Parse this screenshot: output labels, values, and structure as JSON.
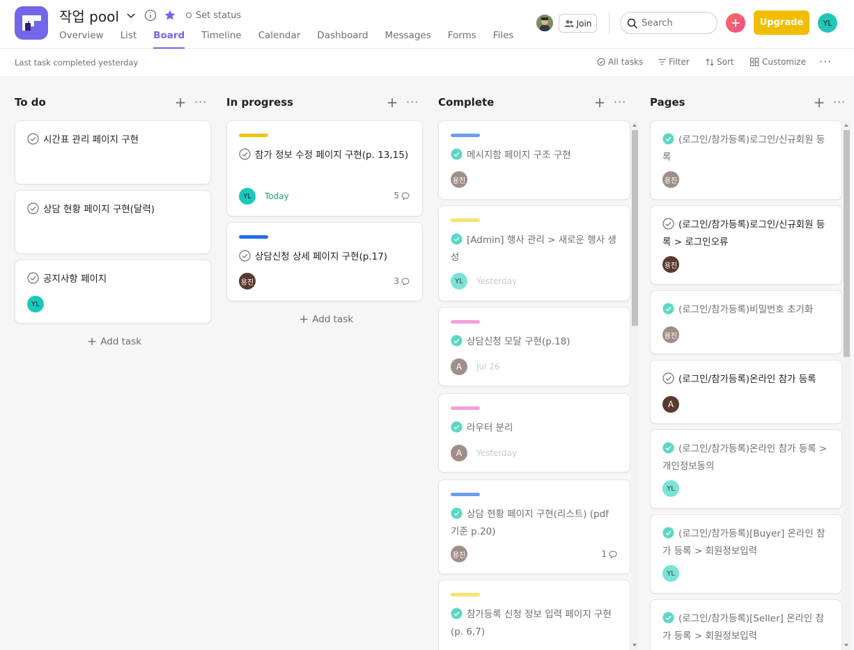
{
  "project": {
    "title": "작업 pool",
    "set_status": "Set status"
  },
  "tabs": [
    "Overview",
    "List",
    "Board",
    "Timeline",
    "Calendar",
    "Dashboard",
    "Messages",
    "Forms",
    "Files"
  ],
  "active_tab": "Board",
  "header": {
    "join": "Join",
    "search_placeholder": "Search",
    "upgrade": "Upgrade",
    "me_initials": "YL"
  },
  "toolbar": {
    "last_completed": "Last task completed yesterday",
    "all_tasks": "All tasks",
    "filter": "Filter",
    "sort": "Sort",
    "customize": "Customize"
  },
  "colors": {
    "accent": "#7266ea",
    "upgrade": "#f1bd00",
    "complete_check": "#58d8c4",
    "yellow": "#f1c40f",
    "blue": "#1f6fe5",
    "light_blue": "#6d9eeb",
    "light_yellow": "#f7e26b",
    "pink": "#f59fdc"
  },
  "columns": [
    {
      "title": "To do",
      "add_task": "Add task",
      "cards": [
        {
          "name": "시간표 관리 페이지 구현"
        },
        {
          "name": "상담 현황 페이지 구현(달력)"
        },
        {
          "name": "공지사항 페이지",
          "assignee": "YL"
        }
      ]
    },
    {
      "title": "In progress",
      "add_task": "Add task",
      "cards": [
        {
          "name": "참가 정보 수정 페이지 구현(p. 13,15)",
          "assignee": "YL",
          "due": "Today",
          "comments": "5",
          "tag_color": "#f1c40f"
        },
        {
          "name": "상담신청 상세 페이지 구현(p.17)",
          "assignee": "용진",
          "comments": "3",
          "tag_color": "#1f6fe5"
        }
      ]
    },
    {
      "title": "Complete",
      "cards": [
        {
          "name": "메시지함 페이지 구조 구현",
          "assignee": "용진",
          "tag_color": "#6d9eeb"
        },
        {
          "name": "[Admin] 행사 관리 > 새로운 행사 생성",
          "assignee": "YL",
          "due": "Yesterday",
          "tag_color": "#f7e26b"
        },
        {
          "name": "상담신청 모달 구현(p.18)",
          "assignee": "A",
          "due": "Jul 26",
          "tag_color": "#f59fdc"
        },
        {
          "name": "라우터 분리",
          "assignee": "A",
          "due": "Yesterday",
          "tag_color": "#f59fdc"
        },
        {
          "name": "상담 현황 페이지 구현(리스트) (pdf 기준 p.20)",
          "assignee": "용진",
          "comments": "1",
          "tag_color": "#6d9eeb"
        },
        {
          "name": "참가등록 신청 정보 입력 페이지 구현(p. 6,7)",
          "tag_color": "#f7e26b"
        }
      ]
    },
    {
      "title": "Pages",
      "cards": [
        {
          "name": "(로그인/참가등록)로그인/신규회원 등록",
          "assignee": "용진",
          "done": true
        },
        {
          "name": "(로그인/참가등록)로그인/신규회원 등록 > 로그인오류",
          "assignee": "용진",
          "done": false
        },
        {
          "name": "(로그인/참가등록)비밀번호 초기화",
          "assignee": "용진",
          "done": true
        },
        {
          "name": "(로그인/참가등록)온라인 참가 등록",
          "assignee": "A",
          "done": false
        },
        {
          "name": "(로그인/참가등록)온라인 참가 등록 > 개인정보동의",
          "assignee": "YL",
          "done": true
        },
        {
          "name": "(로그인/참가등록)[Buyer] 온라인 참가 등록 > 회원정보입력",
          "assignee": "YL",
          "done": true
        },
        {
          "name": "(로그인/참가등록)[Seller] 온라인 참가 등록 > 회원정보입력",
          "done": true
        }
      ]
    }
  ]
}
